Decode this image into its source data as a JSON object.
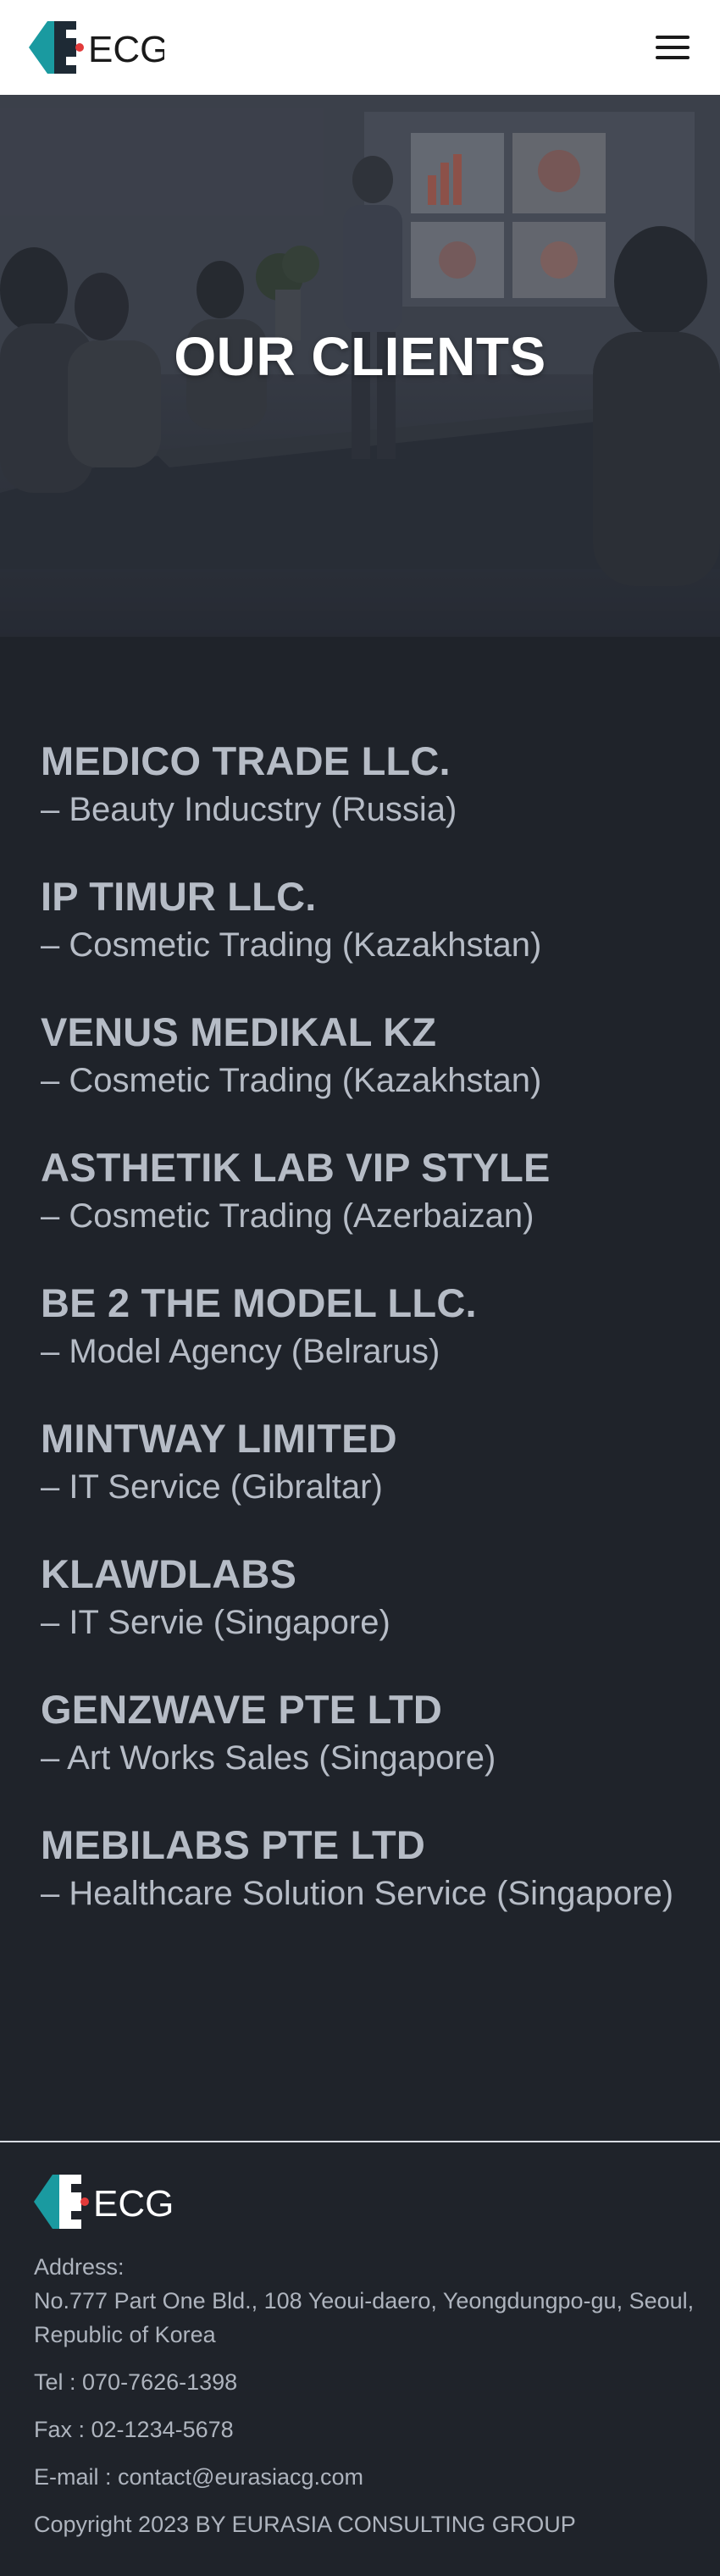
{
  "header": {
    "logo_alt": "ECG",
    "menu_icon": "hamburger-menu-icon"
  },
  "hero": {
    "title": "OUR CLIENTS"
  },
  "clients": [
    {
      "name": "MEDICO TRADE LLC.",
      "desc": "– Beauty Inducstry (Russia)"
    },
    {
      "name": "IP TIMUR LLC.",
      "desc": "– Cosmetic Trading (Kazakhstan)"
    },
    {
      "name": "VENUS MEDIKAL KZ",
      "desc": "– Cosmetic Trading (Kazakhstan)"
    },
    {
      "name": "ASTHETIK LAB VIP STYLE",
      "desc": "– Cosmetic Trading (Azerbaizan)"
    },
    {
      "name": "BE 2 THE MODEL LLC.",
      "desc": "– Model Agency (Belrarus)"
    },
    {
      "name": "MINTWAY LIMITED",
      "desc": "– IT Service (Gibraltar)"
    },
    {
      "name": "KLAWDLABS",
      "desc": "– IT Servie (Singapore)"
    },
    {
      "name": "GENZWAVE PTE LTD",
      "desc": "– Art Works Sales (Singapore)"
    },
    {
      "name": "MEBILABS PTE LTD",
      "desc": "– Healthcare Solution Service (Singapore)"
    }
  ],
  "footer": {
    "address_label": "Address:",
    "address": "No.777 Part One Bld., 108 Yeoui-daero, Yeongdungpo-gu, Seoul, Republic of Korea",
    "tel": "Tel : 070-7626-1398",
    "fax": "Fax : 02-1234-5678",
    "email": "E-mail : contact@eurasiacg.com",
    "copyright": "Copyright 2023 BY EURASIA CONSULTING GROUP"
  },
  "colors": {
    "brand_teal": "#1a9aa0",
    "brand_dark": "#1e2a35",
    "brand_red": "#e23a3a",
    "page_bg": "#1f232a",
    "text": "#b6bcc6"
  }
}
